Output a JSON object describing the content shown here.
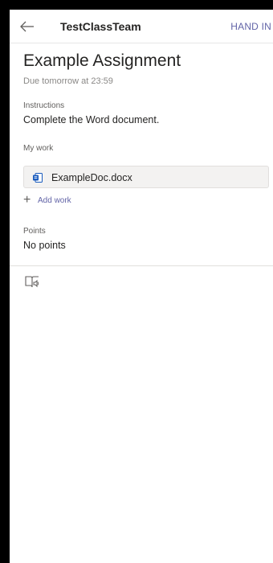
{
  "header": {
    "back_icon": "back-arrow-icon",
    "team_name": "TestClassTeam",
    "hand_in_label": "HAND IN"
  },
  "assignment": {
    "title": "Example Assignment",
    "due": "Due tomorrow at 23:59",
    "instructions_label": "Instructions",
    "instructions_text": "Complete the Word document.",
    "my_work_label": "My work",
    "file": {
      "icon": "word-document-icon",
      "name": "ExampleDoc.docx"
    },
    "add_work_label": "Add work",
    "points_label": "Points",
    "points_value": "No points"
  },
  "footer": {
    "reader_icon": "immersive-reader-icon"
  },
  "colors": {
    "accent": "#6264a7",
    "word_blue": "#185abd",
    "text_primary": "#252423",
    "text_secondary": "#8a8886"
  }
}
